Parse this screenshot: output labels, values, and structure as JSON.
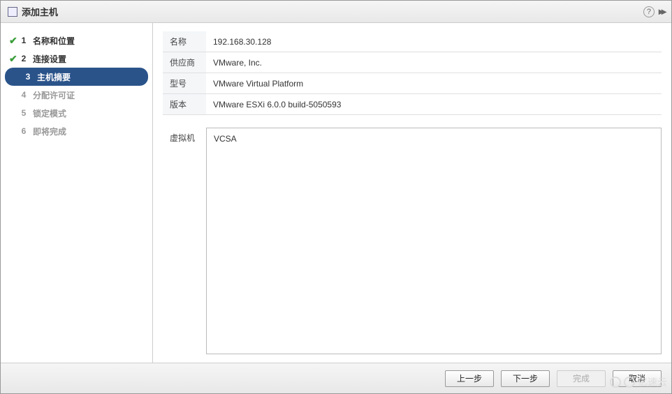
{
  "window": {
    "title": "添加主机"
  },
  "steps": [
    {
      "num": "1",
      "label": "名称和位置",
      "state": "done"
    },
    {
      "num": "2",
      "label": "连接设置",
      "state": "done"
    },
    {
      "num": "3",
      "label": "主机摘要",
      "state": "active"
    },
    {
      "num": "4",
      "label": "分配许可证",
      "state": "upcoming"
    },
    {
      "num": "5",
      "label": "锁定模式",
      "state": "upcoming"
    },
    {
      "num": "6",
      "label": "即将完成",
      "state": "upcoming"
    }
  ],
  "summary": {
    "name_label": "名称",
    "name_value": "192.168.30.128",
    "vendor_label": "供应商",
    "vendor_value": "VMware, Inc.",
    "model_label": "型号",
    "model_value": "VMware Virtual Platform",
    "version_label": "版本",
    "version_value": "VMware ESXi 6.0.0 build-5050593",
    "vm_label": "虚拟机",
    "vm_list": "VCSA"
  },
  "buttons": {
    "back": "上一步",
    "next": "下一步",
    "finish": "完成",
    "cancel": "取消"
  },
  "watermark": "亿速云"
}
